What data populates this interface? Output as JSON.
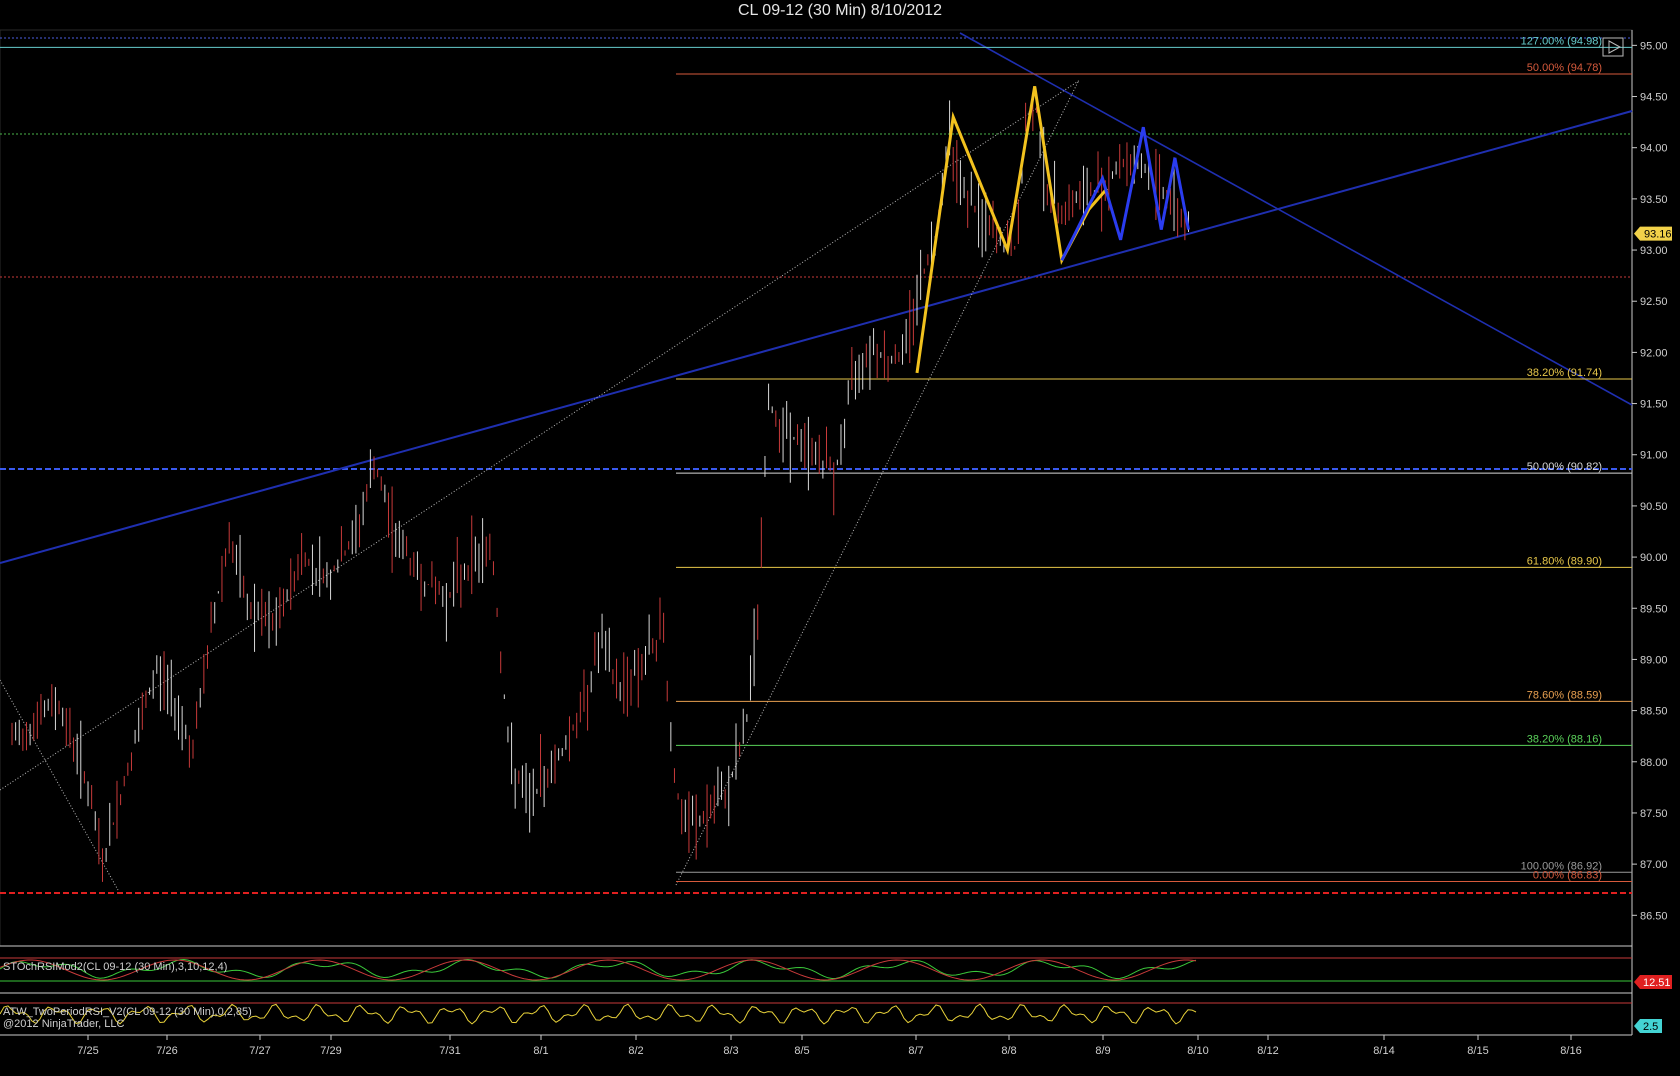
{
  "chart_data": {
    "type": "line",
    "title": "CL 09-12 (30 Min)  8/10/2012",
    "y_range": [
      86.2,
      95.15
    ],
    "y_ticks": [
      "95.00",
      "94.50",
      "94.00",
      "93.50",
      "93.00",
      "92.50",
      "92.00",
      "91.50",
      "91.00",
      "90.50",
      "90.00",
      "89.50",
      "89.00",
      "88.50",
      "88.00",
      "87.50",
      "87.00",
      "86.50"
    ],
    "x_labels": [
      "7/25",
      "7/26",
      "7/27",
      "7/29",
      "7/31",
      "8/1",
      "8/2",
      "8/3",
      "8/5",
      "8/7",
      "8/8",
      "8/9",
      "8/10",
      "8/12",
      "8/14",
      "8/15",
      "8/16"
    ],
    "last_price_label": "93.16",
    "last_price": 93.16,
    "fib_levels": [
      {
        "label": "127.00% (94.98)",
        "price": 94.98,
        "color": "#66cccc"
      },
      {
        "label": "50.00% (94.78)",
        "price": 94.72,
        "color": "#d65a3c"
      },
      {
        "label": "38.20% (91.74)",
        "price": 91.74,
        "color": "#e8c84a"
      },
      {
        "label": "50.00% (90.82)",
        "price": 90.82,
        "color": "#d8d8d8"
      },
      {
        "label": "61.80% (89.90)",
        "price": 89.9,
        "color": "#e8c84a"
      },
      {
        "label": "78.60% (88.59)",
        "price": 88.59,
        "color": "#e8a050"
      },
      {
        "label": "38.20% (88.16)",
        "price": 88.16,
        "color": "#5ad25a"
      },
      {
        "label": "100.00% (86.92)",
        "price": 86.92,
        "color": "#9a9a9a"
      },
      {
        "label": "0.00% (86.83)",
        "price": 86.83,
        "color": "#d65a3c"
      }
    ],
    "price_series": [
      {
        "x": 0,
        "y": 88.2
      },
      {
        "x": 0.5,
        "y": 88.6
      },
      {
        "x": 0.8,
        "y": 87.9
      },
      {
        "x": 1.0,
        "y": 87.0
      },
      {
        "x": 1.3,
        "y": 88.0
      },
      {
        "x": 1.6,
        "y": 88.9
      },
      {
        "x": 1.8,
        "y": 88.6
      },
      {
        "x": 2.0,
        "y": 88.1
      },
      {
        "x": 2.2,
        "y": 89.3
      },
      {
        "x": 2.4,
        "y": 90.2
      },
      {
        "x": 2.6,
        "y": 89.5
      },
      {
        "x": 2.9,
        "y": 89.3
      },
      {
        "x": 3.2,
        "y": 90.0
      },
      {
        "x": 3.5,
        "y": 89.8
      },
      {
        "x": 3.8,
        "y": 90.2
      },
      {
        "x": 4.0,
        "y": 90.9
      },
      {
        "x": 4.2,
        "y": 90.3
      },
      {
        "x": 4.5,
        "y": 89.8
      },
      {
        "x": 4.8,
        "y": 89.6
      },
      {
        "x": 5.1,
        "y": 90.0
      },
      {
        "x": 5.3,
        "y": 90.1
      },
      {
        "x": 5.5,
        "y": 88.0
      },
      {
        "x": 5.7,
        "y": 87.6
      },
      {
        "x": 6.0,
        "y": 88.0
      },
      {
        "x": 6.3,
        "y": 88.5
      },
      {
        "x": 6.5,
        "y": 89.2
      },
      {
        "x": 6.7,
        "y": 88.7
      },
      {
        "x": 7.0,
        "y": 89.0
      },
      {
        "x": 7.2,
        "y": 89.3
      },
      {
        "x": 7.3,
        "y": 88.0
      },
      {
        "x": 7.4,
        "y": 87.4
      },
      {
        "x": 7.6,
        "y": 87.4
      },
      {
        "x": 7.9,
        "y": 87.7
      },
      {
        "x": 8.1,
        "y": 88.3
      },
      {
        "x": 8.25,
        "y": 89.5
      },
      {
        "x": 8.35,
        "y": 91.5
      },
      {
        "x": 8.5,
        "y": 91.3
      },
      {
        "x": 8.7,
        "y": 91.1
      },
      {
        "x": 8.9,
        "y": 91.0
      },
      {
        "x": 9.1,
        "y": 90.8
      },
      {
        "x": 9.3,
        "y": 91.8
      },
      {
        "x": 9.5,
        "y": 92.1
      },
      {
        "x": 9.7,
        "y": 91.9
      },
      {
        "x": 9.85,
        "y": 92.0
      },
      {
        "x": 10.0,
        "y": 92.6
      },
      {
        "x": 10.2,
        "y": 93.1
      },
      {
        "x": 10.35,
        "y": 94.2
      },
      {
        "x": 10.5,
        "y": 93.6
      },
      {
        "x": 10.7,
        "y": 93.3
      },
      {
        "x": 10.9,
        "y": 93.1
      },
      {
        "x": 11.1,
        "y": 93.0
      },
      {
        "x": 11.2,
        "y": 94.2
      },
      {
        "x": 11.3,
        "y": 94.5
      },
      {
        "x": 11.45,
        "y": 93.5
      },
      {
        "x": 11.6,
        "y": 93.4
      },
      {
        "x": 11.8,
        "y": 93.5
      },
      {
        "x": 12.0,
        "y": 93.6
      },
      {
        "x": 12.2,
        "y": 93.8
      },
      {
        "x": 12.4,
        "y": 93.9
      },
      {
        "x": 12.6,
        "y": 93.7
      },
      {
        "x": 12.8,
        "y": 93.5
      },
      {
        "x": 13.0,
        "y": 93.2
      }
    ],
    "yellow_zigzag": [
      [
        10.0,
        91.8
      ],
      [
        10.4,
        94.3
      ],
      [
        11.0,
        93.0
      ],
      [
        11.3,
        94.6
      ],
      [
        11.6,
        92.9
      ],
      [
        11.9,
        93.4
      ],
      [
        12.1,
        93.6
      ]
    ],
    "blue_zigzag": [
      [
        11.6,
        92.9
      ],
      [
        12.05,
        93.7
      ],
      [
        12.25,
        93.1
      ],
      [
        12.5,
        94.2
      ],
      [
        12.7,
        93.2
      ],
      [
        12.85,
        93.9
      ],
      [
        13.0,
        93.2
      ]
    ],
    "rsi_label": "STOchRSIMod2(CL 09-12 (30 Min),3,10,12,4)",
    "rsi_value_label": "12.51",
    "rsi2_label": "ATW_TwoPeriodRSI_V2(CL 09-12 (30 Min),0,2,85)",
    "rsi2_value_label": "2.5",
    "copyright": "@2012 NinjaTrader, LLC"
  }
}
